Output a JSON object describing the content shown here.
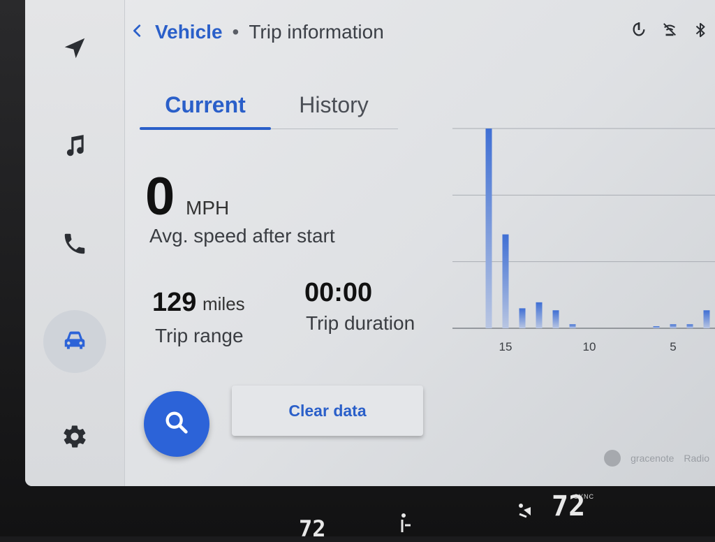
{
  "header": {
    "back_label": "<",
    "breadcrumb_vehicle": "Vehicle",
    "breadcrumb_separator": "•",
    "breadcrumb_page": "Trip information"
  },
  "tabs": [
    {
      "label": "Current",
      "active": true
    },
    {
      "label": "History",
      "active": false
    }
  ],
  "stats": {
    "avg_speed_value": "0",
    "avg_speed_unit": "MPH",
    "avg_speed_label": "Avg. speed after start",
    "trip_range_value": "129",
    "trip_range_unit": "miles",
    "trip_range_label": "Trip range",
    "trip_duration_value": "00:00",
    "trip_duration_label": "Trip duration"
  },
  "actions": {
    "clear_label": "Clear data"
  },
  "sidebar": {
    "items": [
      {
        "name": "navigation",
        "icon": "navigation-arrow-icon",
        "active": false
      },
      {
        "name": "music",
        "icon": "music-note-icon",
        "active": false
      },
      {
        "name": "phone",
        "icon": "phone-icon",
        "active": false
      },
      {
        "name": "vehicle",
        "icon": "car-icon",
        "active": true
      },
      {
        "name": "settings",
        "icon": "gear-icon",
        "active": false
      }
    ]
  },
  "status_icons": [
    "wireless-charging-icon",
    "no-signal-icon",
    "bluetooth-icon"
  ],
  "attribution": {
    "gracenote": "gracenote",
    "radio": "Radio"
  },
  "climate": {
    "left_temp": "72",
    "right_temp": "72",
    "sync_label": "SYNC"
  },
  "colors": {
    "accent": "#2a5fc9",
    "bar": "#3f6fd4",
    "screen_bg": "#e6e7e9"
  },
  "chart_data": {
    "type": "bar",
    "x_ticks": [
      "15",
      "10",
      "5"
    ],
    "x": [
      16,
      15,
      14,
      13,
      12,
      11,
      10,
      9,
      8,
      7,
      6,
      5,
      4,
      3
    ],
    "values": [
      100,
      47,
      10,
      13,
      9,
      2,
      0,
      0,
      0,
      0,
      1,
      2,
      2,
      9
    ],
    "xlim": [
      16.5,
      2.5
    ],
    "ylim": [
      0,
      100
    ],
    "grid": true
  }
}
